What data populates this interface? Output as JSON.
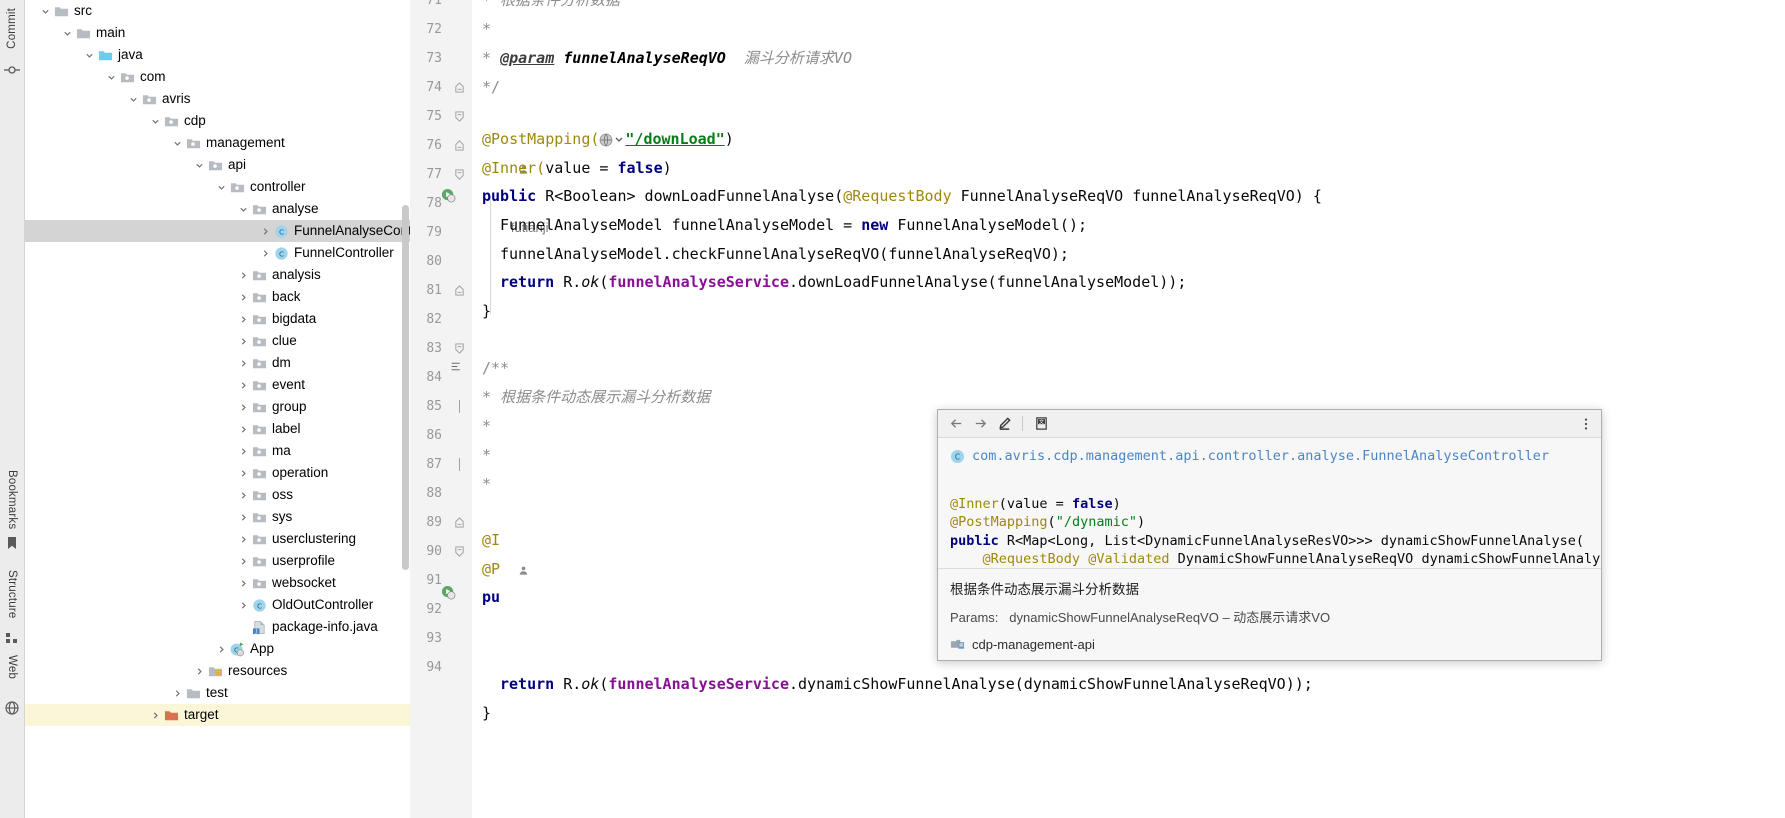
{
  "app": {
    "theme_bg": "#ffffff",
    "accent": "#4a86c7"
  },
  "toolstrip": {
    "items": [
      {
        "label": "Commit",
        "icon": "commit-icon"
      },
      {
        "label": "Bookmarks",
        "icon": "bookmark-icon"
      },
      {
        "label": "Structure",
        "icon": "structure-icon"
      },
      {
        "label": "Web",
        "icon": "web-icon"
      }
    ]
  },
  "project_tree": {
    "rows": [
      {
        "label": "src",
        "indent": 0,
        "arrow": "down",
        "icon": "folder-plain",
        "state": "normal"
      },
      {
        "label": "main",
        "indent": 1,
        "arrow": "down",
        "icon": "folder-plain",
        "state": "normal"
      },
      {
        "label": "java",
        "indent": 2,
        "arrow": "down",
        "icon": "folder-source",
        "state": "normal"
      },
      {
        "label": "com",
        "indent": 3,
        "arrow": "down",
        "icon": "folder-pkg",
        "state": "normal"
      },
      {
        "label": "avris",
        "indent": 4,
        "arrow": "down",
        "icon": "folder-pkg",
        "state": "normal"
      },
      {
        "label": "cdp",
        "indent": 5,
        "arrow": "down",
        "icon": "folder-pkg",
        "state": "normal"
      },
      {
        "label": "management",
        "indent": 6,
        "arrow": "down",
        "icon": "folder-pkg",
        "state": "normal"
      },
      {
        "label": "api",
        "indent": 7,
        "arrow": "down",
        "icon": "folder-pkg",
        "state": "normal"
      },
      {
        "label": "controller",
        "indent": 8,
        "arrow": "down",
        "icon": "folder-pkg",
        "state": "normal"
      },
      {
        "label": "analyse",
        "indent": 9,
        "arrow": "down",
        "icon": "folder-pkg",
        "state": "normal"
      },
      {
        "label": "FunnelAnalyseController",
        "indent": 10,
        "arrow": "right",
        "icon": "class-java",
        "state": "selected"
      },
      {
        "label": "FunnelController",
        "indent": 10,
        "arrow": "right",
        "icon": "class-java",
        "state": "normal"
      },
      {
        "label": "analysis",
        "indent": 9,
        "arrow": "right",
        "icon": "folder-pkg",
        "state": "normal"
      },
      {
        "label": "back",
        "indent": 9,
        "arrow": "right",
        "icon": "folder-pkg",
        "state": "normal"
      },
      {
        "label": "bigdata",
        "indent": 9,
        "arrow": "right",
        "icon": "folder-pkg",
        "state": "normal"
      },
      {
        "label": "clue",
        "indent": 9,
        "arrow": "right",
        "icon": "folder-pkg",
        "state": "normal"
      },
      {
        "label": "dm",
        "indent": 9,
        "arrow": "right",
        "icon": "folder-pkg",
        "state": "normal"
      },
      {
        "label": "event",
        "indent": 9,
        "arrow": "right",
        "icon": "folder-pkg",
        "state": "normal"
      },
      {
        "label": "group",
        "indent": 9,
        "arrow": "right",
        "icon": "folder-pkg",
        "state": "normal"
      },
      {
        "label": "label",
        "indent": 9,
        "arrow": "right",
        "icon": "folder-pkg",
        "state": "normal"
      },
      {
        "label": "ma",
        "indent": 9,
        "arrow": "right",
        "icon": "folder-pkg",
        "state": "normal"
      },
      {
        "label": "operation",
        "indent": 9,
        "arrow": "right",
        "icon": "folder-pkg",
        "state": "normal"
      },
      {
        "label": "oss",
        "indent": 9,
        "arrow": "right",
        "icon": "folder-pkg",
        "state": "normal"
      },
      {
        "label": "sys",
        "indent": 9,
        "arrow": "right",
        "icon": "folder-pkg",
        "state": "normal"
      },
      {
        "label": "userclustering",
        "indent": 9,
        "arrow": "right",
        "icon": "folder-pkg",
        "state": "normal"
      },
      {
        "label": "userprofile",
        "indent": 9,
        "arrow": "right",
        "icon": "folder-pkg",
        "state": "normal"
      },
      {
        "label": "websocket",
        "indent": 9,
        "arrow": "right",
        "icon": "folder-pkg",
        "state": "normal"
      },
      {
        "label": "OldOutController",
        "indent": 9,
        "arrow": "right",
        "icon": "class-java",
        "state": "normal"
      },
      {
        "label": "package-info.java",
        "indent": 9,
        "arrow": "none",
        "icon": "file-java",
        "state": "normal"
      },
      {
        "label": "App",
        "indent": 8,
        "arrow": "right",
        "icon": "class-run",
        "state": "normal"
      },
      {
        "label": "resources",
        "indent": 7,
        "arrow": "right",
        "icon": "folder-res",
        "state": "normal"
      },
      {
        "label": "test",
        "indent": 6,
        "arrow": "right",
        "icon": "folder-plain",
        "state": "normal"
      },
      {
        "label": "target",
        "indent": 5,
        "arrow": "right",
        "icon": "folder-excluded",
        "state": "highlight"
      }
    ]
  },
  "editor": {
    "line_numbers": [
      "71",
      "72",
      "73",
      "74",
      "75",
      "76",
      "77",
      "78",
      "79",
      "80",
      "81",
      "82",
      "83",
      "84",
      "85",
      "86",
      "87",
      "88",
      "89",
      "90",
      "91",
      "92",
      "93",
      "94"
    ],
    "author_inlay": "futianji",
    "lines": [
      {
        "n": "71",
        "text": "* 根据条件分析数据"
      },
      {
        "n": "72",
        "text": "*"
      },
      {
        "n": "73",
        "text": "* @param funnelAnalyseReqVO 漏斗分析请求VO"
      },
      {
        "n": "74",
        "text": "*/"
      },
      {
        "n": "75",
        "text": "@PostMapping(\"/downLoad\")"
      },
      {
        "n": "76",
        "text": "@Inner(value = false)"
      },
      {
        "n": "77",
        "text": "public R<Boolean> downLoadFunnelAnalyse(@RequestBody FunnelAnalyseReqVO funnelAnalyseReqVO) {"
      },
      {
        "n": "78",
        "text": "FunnelAnalyseModel funnelAnalyseModel = new FunnelAnalyseModel();"
      },
      {
        "n": "79",
        "text": "funnelAnalyseModel.checkFunnelAnalyseReqVO(funnelAnalyseReqVO);"
      },
      {
        "n": "80",
        "text": "return R.ok(funnelAnalyseService.downLoadFunnelAnalyse(funnelAnalyseModel));"
      },
      {
        "n": "81",
        "text": "}"
      },
      {
        "n": "82",
        "text": ""
      },
      {
        "n": "83",
        "text": "/**"
      },
      {
        "n": "84",
        "text": "* 根据条件动态展示漏斗分析数据"
      },
      {
        "n": "85",
        "text": "*"
      },
      {
        "n": "86",
        "text": "*"
      },
      {
        "n": "87",
        "text": "*"
      },
      {
        "n": "88",
        "text": "@I"
      },
      {
        "n": "89",
        "text": "@P"
      },
      {
        "n": "90",
        "text": "pu"
      },
      {
        "n": "91",
        "text": ""
      },
      {
        "n": "92",
        "text": ""
      },
      {
        "n": "93",
        "text": "return R.ok(funnelAnalyseService.dynamicShowFunnelAnalyse(dynamicShowFunnelAnalyseReqVO));"
      },
      {
        "n": "94",
        "text": "}"
      }
    ],
    "l71_comment": "* 根据条件分析数据",
    "l72_comment": "*",
    "l73_star": "*",
    "l73_tag": "@param",
    "l73_param": "funnelAnalyseReqVO",
    "l73_desc": "漏斗分析请求VO",
    "l74_comment": "*/",
    "l75_ann": "@PostMapping(",
    "l75_str": "\"/downLoad\"",
    "l75_close": ")",
    "l76_ann": "@Inner(",
    "l76_mid": "value = ",
    "l76_kw": "false",
    "l76_close": ")",
    "l77_kw": "public",
    "l77_a": " R<Boolean> downLoadFunnelAnalyse(",
    "l77_ann": "@RequestBody",
    "l77_b": " FunnelAnalyseReqVO funnelAnalyseReqVO) {",
    "l78_a": "FunnelAnalyseModel funnelAnalyseModel = ",
    "l78_kw": "new",
    "l78_b": " FunnelAnalyseModel();",
    "l79": "funnelAnalyseModel.checkFunnelAnalyseReqVO(funnelAnalyseReqVO);",
    "l80_kw": "return",
    "l80_a": " R.",
    "l80_ok": "ok",
    "l80_b": "(",
    "l80_svc": "funnelAnalyseService",
    "l80_c": ".downLoadFunnelAnalyse(funnelAnalyseModel));",
    "l81": "}",
    "l83": "/**",
    "l84_star": "*",
    "l84_text": "根据条件动态展示漏斗分析数据",
    "l85": "*",
    "l86": "*",
    "l87": "*",
    "l88": "@I",
    "l89": "@P",
    "l90": "pu",
    "l90_tail": "nalyse(",
    "l93_kw": "return",
    "l93_a": " R.",
    "l93_ok": "ok",
    "l93_b": "(",
    "l93_svc": "funnelAnalyseService",
    "l93_c": ".dynamicShowFunnelAnalyse(dynamicShowFunnelAnalyseReqVO));",
    "l94": "}"
  },
  "doc_popup": {
    "toolbar": {
      "back": "back-arrow",
      "forward": "forward-arrow",
      "edit": "edit-pencil",
      "translate": "translate-icon",
      "more": "more-options"
    },
    "fqn": "com.avris.cdp.management.api.controller.analyse.FunnelAnalyseController",
    "signature_lines": [
      {
        "kind": "ann",
        "text": "@Inner(value = false)"
      },
      {
        "kind": "ann2",
        "text": "@PostMapping(\"/dynamic\")"
      },
      {
        "kind": "sig",
        "text": "public R<Map<Long, List<DynamicFunnelAnalyseResVO>>> dynamicShowFunnelAnalyse("
      },
      {
        "kind": "par",
        "text": "    @RequestBody @Validated DynamicShowFunnelAnalyseReqVO dynamicShowFunnelAnalyseReqVO"
      },
      {
        "kind": "end",
        "text": ")"
      }
    ],
    "sig_inner_ann": "@Inner",
    "sig_inner_open": "(value = ",
    "sig_inner_kw": "false",
    "sig_inner_close": ")",
    "sig_post_ann": "@PostMapping",
    "sig_post_open": "(",
    "sig_post_str": "\"/dynamic\"",
    "sig_post_close": ")",
    "sig_kw": "public",
    "sig_rest": " R<Map<Long, List<DynamicFunnelAnalyseResVO>>> dynamicShowFunnelAnalyse(",
    "sig_param_ann1": "@RequestBody",
    "sig_param_ann2": "@Validated",
    "sig_param_rest": " DynamicShowFunnelAnalyseReqVO dynamicShowFunnelAnalyseReqVO",
    "sig_close": ")",
    "description": "根据条件动态展示漏斗分析数据",
    "params_label": "Params:",
    "params_value": "dynamicShowFunnelAnalyseReqVO – 动态展示请求VO",
    "module": "cdp-management-api"
  }
}
